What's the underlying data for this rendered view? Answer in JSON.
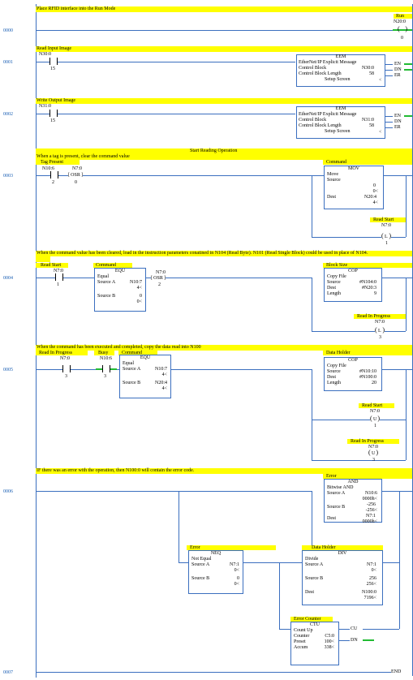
{
  "rungs": [
    {
      "num": "0000",
      "comment": "Place RFID interface into the Run Mode",
      "labels": {
        "coil_title": "Run",
        "coil_addr": "N20:0",
        "coil_bit": "0"
      }
    },
    {
      "num": "0001",
      "comment": "Read Input Image",
      "contact_addr": "N30:0",
      "contact_bit": "15",
      "eem": {
        "title": "EEM",
        "name": "EtherNet/IP Explicit Message",
        "cb_label": "Control Block",
        "cb_val": "N30:0",
        "cbl_label": "Control Block Length",
        "cbl_val": "58",
        "setup": "Setup Screen",
        "lt": "<"
      },
      "out": [
        "EN",
        "DN",
        "ER"
      ]
    },
    {
      "num": "0002",
      "comment": "Write Output Image",
      "contact_addr": "N31:0",
      "contact_bit": "15",
      "eem": {
        "title": "EEM",
        "name": "EtherNet/IP Explicit Message",
        "cb_label": "Control Block",
        "cb_val": "N31:0",
        "cbl_label": "Control Block Length",
        "cbl_val": "58",
        "setup": "Setup Screen",
        "lt": "<"
      },
      "out": [
        "EN",
        "DN",
        "ER"
      ]
    },
    {
      "num": "0003",
      "section": "Start Reading Operation",
      "comment": "When a tag is present, clear the command value",
      "tag_label": "Tag Present",
      "tag_addr": "N10:6",
      "tag_bit": "2",
      "osr_addr": "N7:0",
      "osr_bit": "0",
      "osr_text": "OSR",
      "cmd_label": "Command",
      "mov": {
        "title": "MOV",
        "name": "Move",
        "src": "Source",
        "src_val": "0",
        "src_v2": "0<",
        "dest": "Dest",
        "dest_val": "N20:4",
        "dest_v2": "4<"
      },
      "rs": {
        "label": "Read Start",
        "addr": "N7:0",
        "l": "L",
        "bit": "1"
      }
    },
    {
      "num": "0004",
      "comment": "When the command value has been cleared, load in the instruction parameters conatined in N104 (Read Byte).  N101 (Read Single Block) could be used in place of N104.",
      "rs_label": "Read Start",
      "rs_addr": "N7:0",
      "rs_bit": "1",
      "cmd_label": "Command",
      "equ": {
        "title": "EQU",
        "name": "Equal",
        "sa": "Source A",
        "sa_val": "N10:7",
        "sa_v2": "4<",
        "sb": "Source B",
        "sb_val": "0",
        "sb_v2": "0<"
      },
      "osr_addr": "N7:0",
      "osr_bit": "2",
      "osr_text": "OSR",
      "bs_label": "Block Size",
      "cop": {
        "title": "COP",
        "name": "Copy File",
        "src": "Source",
        "src_val": "#N104:0",
        "dest": "Dest",
        "dest_val": "#N20:3",
        "len": "Length",
        "len_val": "9"
      },
      "rip": {
        "label": "Read In Progress",
        "addr": "N7:0",
        "l": "L",
        "bit": "3"
      }
    },
    {
      "num": "0005",
      "comment": "When the command has been executed and completed, copy the data read into N100",
      "rip_label": "Read In Progress",
      "rip_addr": "N7:0",
      "rip_bit": "3",
      "busy_label": "Busy",
      "busy_addr": "N10:6",
      "busy_bit": "3",
      "cmd_label": "Command",
      "equ": {
        "title": "EQU",
        "name": "Equal",
        "sa": "Source A",
        "sa_val": "N10:7",
        "sa_v2": "4<",
        "sb": "Source B",
        "sb_val": "N20:4",
        "sb_v2": "4<"
      },
      "dh_label": "Data Holder",
      "cop": {
        "title": "COP",
        "name": "Copy File",
        "src": "Source",
        "src_val": "#N10:10",
        "dest": "Dest",
        "dest_val": "#N100:0",
        "len": "Length",
        "len_val": "20"
      },
      "rs": {
        "label": "Read Start",
        "addr": "N7:0",
        "u": "U",
        "bit": "1"
      },
      "rip": {
        "label": "Read In Progress",
        "addr": "N7:0",
        "u": "U",
        "bit": "3"
      }
    },
    {
      "num": "0006",
      "comment": "IF there was an error with the operation, then N100:0 will contain the error code.",
      "err_label": "Error",
      "and": {
        "title": "AND",
        "name": "Bitwise AND",
        "sa": "Source A",
        "sa_val": "N10:6",
        "sa_v2": "0000h<",
        "sb": "Source B",
        "sb_val": "-256",
        "sb_v2": "-256<",
        "dest": "Dest",
        "dest_val": "N7:1",
        "dest_v2": "0000h<"
      },
      "err2_label": "Error",
      "neq": {
        "title": "NEQ",
        "name": "Not Equal",
        "sa": "Source A",
        "sa_val": "N7:1",
        "sa_v2": "0<",
        "sb": "Source B",
        "sb_val": "0",
        "sb_v2": "0<"
      },
      "dh_label": "Data Holder",
      "div": {
        "title": "DIV",
        "name": "Divide",
        "sa": "Source A",
        "sa_val": "N7:1",
        "sa_v2": "0<",
        "sb": "Source B",
        "sb_val": "256",
        "sb_v2": "256<",
        "dest": "Dest",
        "dest_val": "N100:0",
        "dest_v2": "7196<"
      },
      "ec_label": "Error Counter",
      "ctu": {
        "title": "CTU",
        "name": "Count Up",
        "counter": "Counter",
        "counter_val": "C5:0",
        "preset": "Preset",
        "preset_val": "100<",
        "accum": "Accum",
        "accum_val": "338<"
      },
      "ctu_out": [
        "CU",
        "DN"
      ]
    },
    {
      "num": "0007",
      "end": "END"
    }
  ]
}
